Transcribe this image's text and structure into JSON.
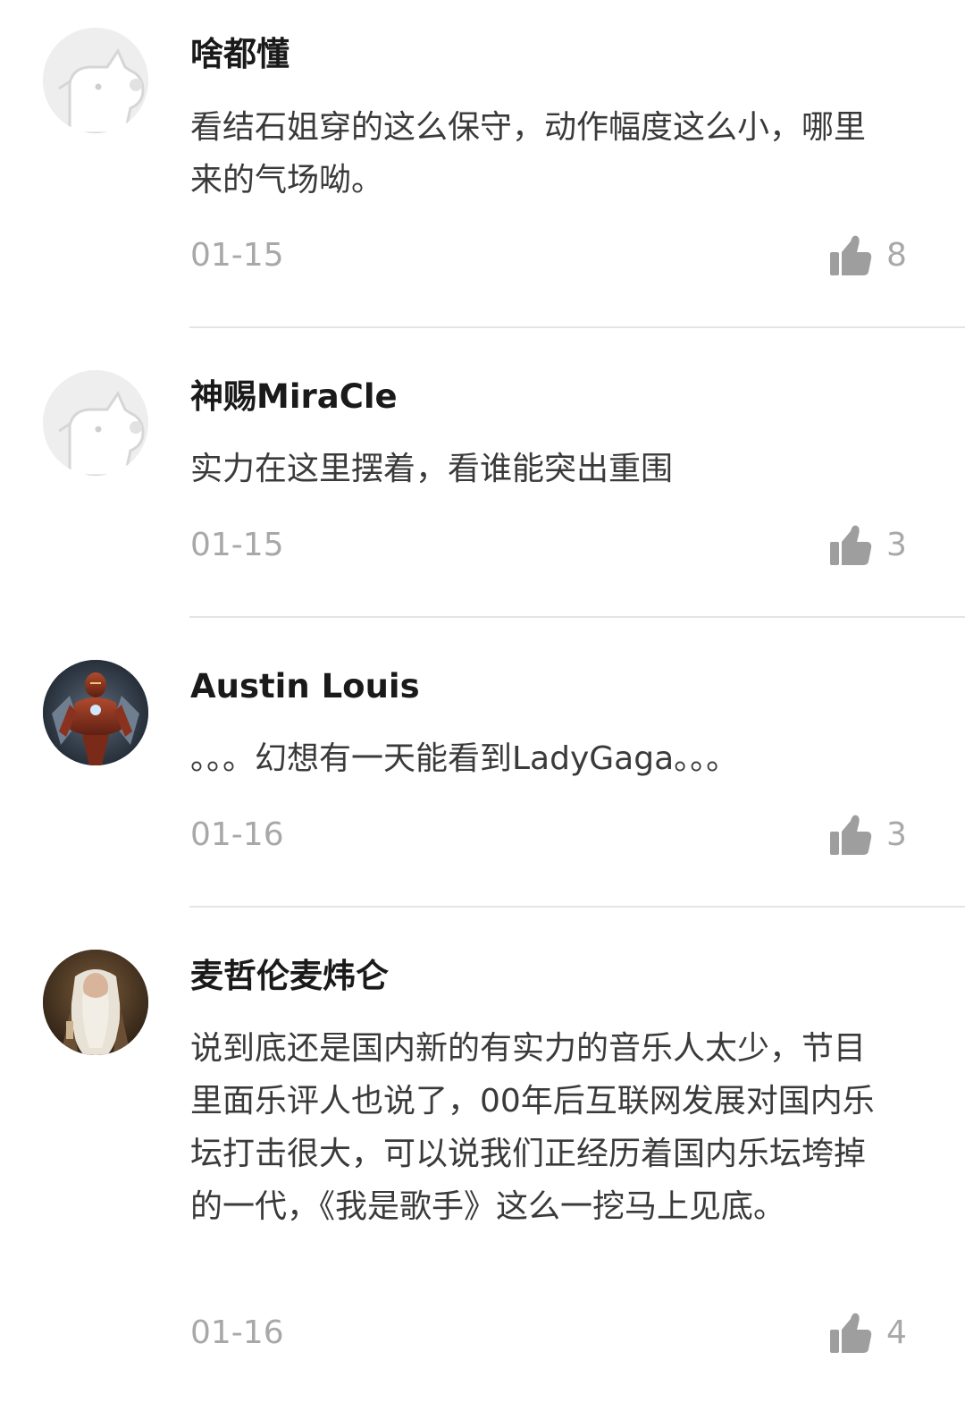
{
  "comments": [
    {
      "avatar": "default-dog-avatar",
      "username": "啥都懂",
      "content": "看结石姐穿的这么保守，动作幅度这么小，哪里来的气场呦。",
      "date": "01-15",
      "likes": "8"
    },
    {
      "avatar": "default-dog-avatar",
      "username": "神赐MiraCle",
      "content": "实力在这里摆着，看谁能突出重围",
      "date": "01-15",
      "likes": "3"
    },
    {
      "avatar": "ironman-photo-avatar",
      "username": "Austin Louis",
      "content": "。。。幻想有一天能看到LadyGaga。。。",
      "date": "01-16",
      "likes": "3"
    },
    {
      "avatar": "wizard-photo-avatar",
      "username": "麦哲伦麦炜仑",
      "content": "说到底还是国内新的有实力的音乐人太少，节目里面乐评人也说了，00年后互联网发展对国内乐坛打击很大，可以说我们正经历着国内乐坛垮掉的一代，《我是歌手》这么一挖马上见底。",
      "date": "01-16",
      "likes": "4"
    }
  ],
  "colors": {
    "username": "#1a1a1a",
    "content": "#3a3a3a",
    "meta": "#a8a8a8",
    "divider": "#e4e4e4",
    "like_icon": "#9e9e9e"
  }
}
